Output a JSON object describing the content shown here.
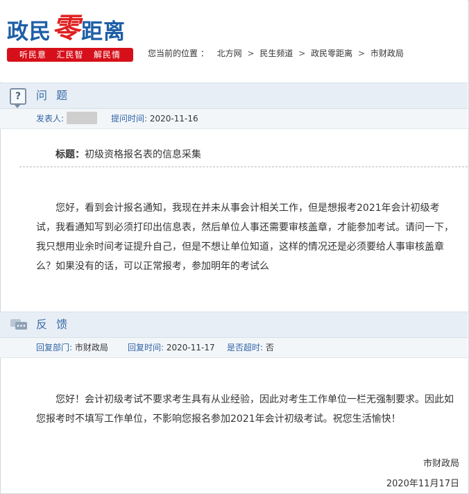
{
  "header": {
    "logo_pre": "政民",
    "logo_accent": "零",
    "logo_post": "距离",
    "slogan": [
      "听民意",
      "汇民智",
      "解民情"
    ],
    "breadcrumb_label": "您当前的位置 ：",
    "breadcrumb": [
      "北方网",
      "民生频道",
      "政民零距离",
      "市财政局"
    ]
  },
  "question": {
    "section_title": "问 题",
    "poster_label": "发表人:",
    "time_label": "提问时间:",
    "time_value": "2020-11-16",
    "subject_label": "标题：",
    "subject_value": "初级资格报名表的信息采集",
    "body": "您好，看到会计报名通知，我现在并未从事会计相关工作，但是想报考2021年会计初级考试，我看通知写到必须打印出信息表，然后单位人事还需要审核盖章，才能参加考试。请问一下，我只想用业余时间考证提升自己，但是不想让单位知道，这样的情况还是必须要给人事审核盖章么？如果没有的话，可以正常报考，参加明年的考试么"
  },
  "reply": {
    "section_title": "反 馈",
    "dept_label": "回复部门:",
    "dept_value": "市财政局",
    "time_label": "回复时间:",
    "time_value": "2020-11-17",
    "overdue_label": "是否超时:",
    "overdue_value": "否",
    "body": "您好！会计初级考试不要求考生具有从业经验，因此对考生工作单位一栏无强制要求。因此如您报考时不填写工作单位，不影响您报名参加2021年会计初级考试。祝您生活愉快！",
    "signature": "市财政局",
    "date": "2020年11月17日"
  }
}
